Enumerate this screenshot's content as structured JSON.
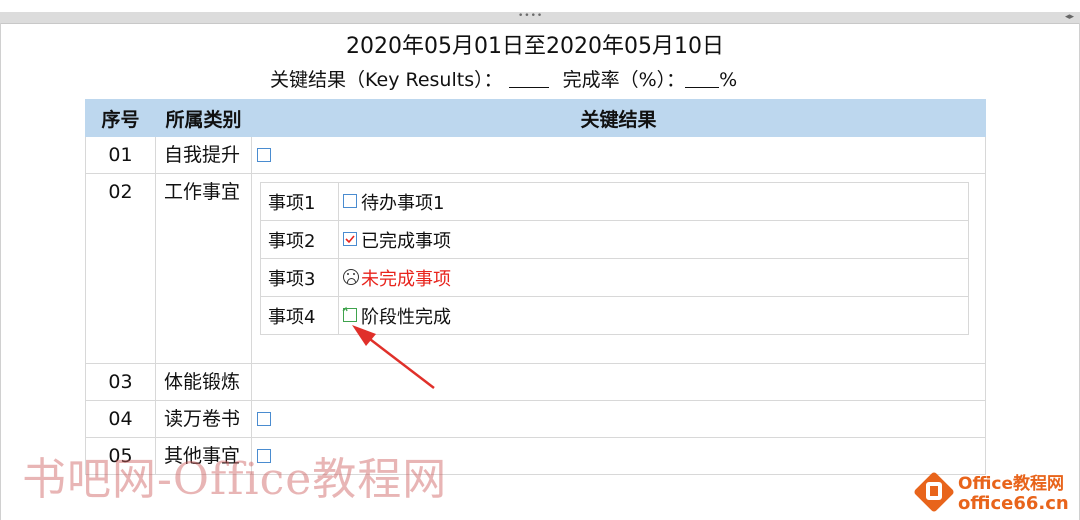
{
  "header": {
    "title": "2020年05月01日至2020年05月10日",
    "subtitle_label": "关键结果（Key Results）：",
    "completion_label": "完成率（%）：",
    "percent_sign": "%"
  },
  "table": {
    "headers": [
      "序号",
      "所属类别",
      "关键结果"
    ],
    "rows": [
      {
        "num": "01",
        "category": "自我提升"
      },
      {
        "num": "02",
        "category": "工作事宜"
      },
      {
        "num": "03",
        "category": "体能锻炼"
      },
      {
        "num": "04",
        "category": "读万卷书"
      },
      {
        "num": "05",
        "category": "其他事宜"
      }
    ],
    "items": [
      {
        "label": "事项1",
        "text": "待办事项1",
        "status": "todo"
      },
      {
        "label": "事项2",
        "text": "已完成事项",
        "status": "done"
      },
      {
        "label": "事项3",
        "text": "未完成事项",
        "status": "failed",
        "color": "#e8241d"
      },
      {
        "label": "事项4",
        "text": "阶段性完成",
        "status": "partial"
      }
    ]
  },
  "watermark": "书吧网-Office教程网",
  "logo": {
    "line1": "Office教程网",
    "line2": "office66.cn"
  },
  "colors": {
    "header_bg": "#bdd7ee",
    "checkbox": "#4a8cd0",
    "alert_red": "#e8241d",
    "arrow": "#e0302a",
    "brand": "#e8641b"
  }
}
